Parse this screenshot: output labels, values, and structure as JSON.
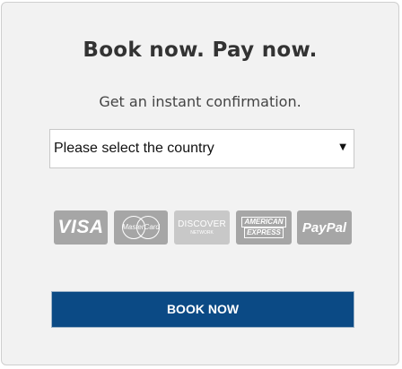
{
  "booking": {
    "title": "Book now. Pay now.",
    "subtitle": "Get an instant confirmation.",
    "country_select": {
      "selected": "Please select the country",
      "caret": "▼"
    },
    "payment_methods": {
      "visa": "VISA",
      "mastercard": "MasterCard",
      "discover": "DISCOVER",
      "discover_sub": "NETWORK",
      "amex_line1": "AMERICAN",
      "amex_line2": "EXPRESS",
      "paypal": "PayPal"
    },
    "book_button": "BOOK NOW"
  },
  "colors": {
    "panel_bg": "#f2f2f2",
    "button_bg": "#0b4a85",
    "card_bg": "#a6a6a6"
  }
}
